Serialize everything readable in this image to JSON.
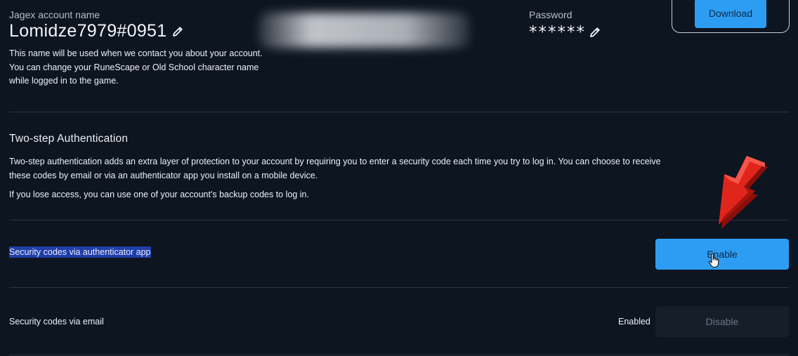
{
  "account": {
    "name_label": "Jagex account name",
    "name_value": "Lomidze7979#0951",
    "description_line1": "This name will be used when we contact you about your account.",
    "description_line2": "You can change your RuneScape or Old School character name",
    "description_line3": "while logged in to the game."
  },
  "password": {
    "label": "Password",
    "masked_value": "******"
  },
  "download": {
    "button_label": "Download"
  },
  "two_step": {
    "title": "Two-step Authentication",
    "description_line1": "Two-step authentication adds an extra layer of protection to your account by requiring you to enter a security code each time you try to log in. You can choose to receive",
    "description_line2": "these codes by email or via an authenticator app you install on a mobile device.",
    "backup_note": "If you lose access, you can use one of your account's backup codes to log in."
  },
  "methods": [
    {
      "label": "Security codes via authenticator app",
      "status": "",
      "button_label": "Enable"
    },
    {
      "label": "Security codes via email",
      "status": "Enabled",
      "button_label": "Disable"
    }
  ],
  "colors": {
    "background": "#0d1520",
    "primary_button": "#2d9df4",
    "selection_highlight": "#1f3ea8",
    "annotation_arrow": "#e0261c"
  },
  "icons": [
    "pencil-icon",
    "cursor-pointer-icon",
    "red-arrow-annotation"
  ]
}
